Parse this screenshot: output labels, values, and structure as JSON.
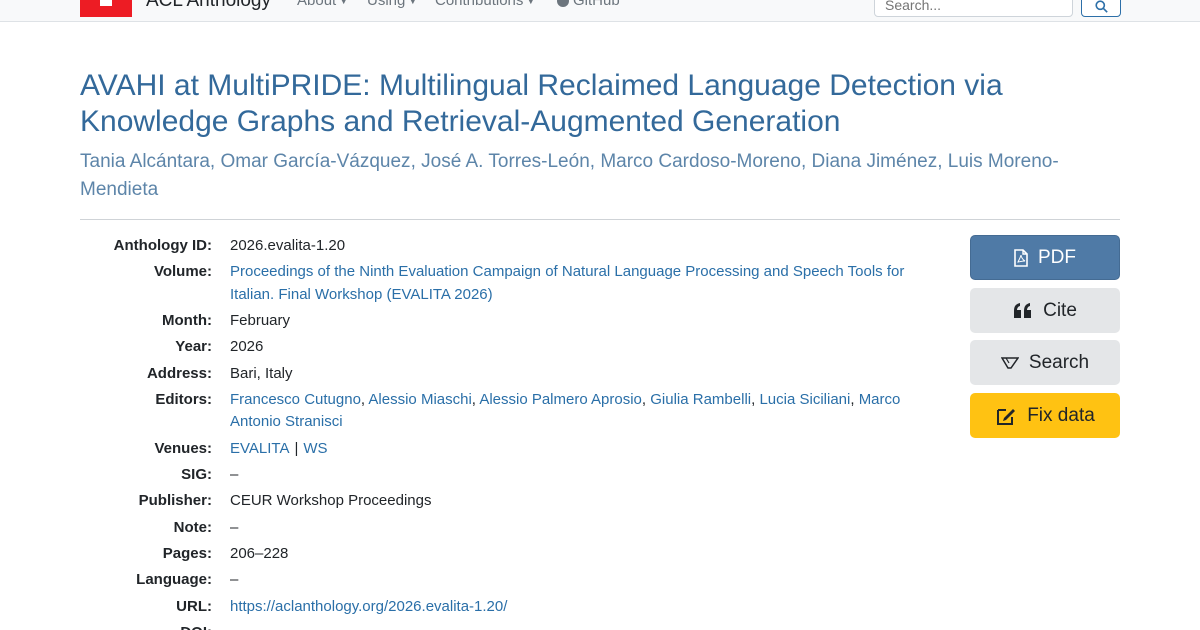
{
  "nav": {
    "brand": "ACL Anthology",
    "items": [
      {
        "label": "About"
      },
      {
        "label": "Using"
      },
      {
        "label": "Contributions"
      },
      {
        "label": "GitHub"
      }
    ],
    "search_placeholder": "Search..."
  },
  "paper": {
    "title": "AVAHI at MultiPRIDE: Multilingual Reclaimed Language Detection via Knowledge Graphs and Retrieval-Augmented Generation",
    "authors": [
      "Tania Alcántara",
      "Omar García-Vázquez",
      "José A. Torres-León",
      "Marco Cardoso-Moreno",
      "Diana Jiménez",
      "Luis Moreno-Mendieta"
    ]
  },
  "details": {
    "anthology_id": {
      "label": "Anthology ID:",
      "value": "2026.evalita-1.20"
    },
    "volume": {
      "label": "Volume:",
      "value": "Proceedings of the Ninth Evaluation Campaign of Natural Language Processing and Speech Tools for Italian. Final Workshop (EVALITA 2026)"
    },
    "month": {
      "label": "Month:",
      "value": "February"
    },
    "year": {
      "label": "Year:",
      "value": "2026"
    },
    "address": {
      "label": "Address:",
      "value": "Bari, Italy"
    },
    "editors": {
      "label": "Editors:",
      "values": [
        "Francesco Cutugno",
        "Alessio Miaschi",
        "Alessio Palmero Aprosio",
        "Giulia Rambelli",
        "Lucia Siciliani",
        "Marco Antonio Stranisci"
      ]
    },
    "venues": {
      "label": "Venues:",
      "values": [
        "EVALITA",
        "WS"
      ],
      "separator": "|"
    },
    "sig": {
      "label": "SIG:",
      "value": "–"
    },
    "publisher": {
      "label": "Publisher:",
      "value": "CEUR Workshop Proceedings"
    },
    "note": {
      "label": "Note:",
      "value": "–"
    },
    "pages": {
      "label": "Pages:",
      "value": "206–228"
    },
    "language": {
      "label": "Language:",
      "value": "–"
    },
    "url": {
      "label": "URL:",
      "value": "https://aclanthology.org/2026.evalita-1.20/"
    },
    "doi": {
      "label": "DOI:",
      "value": ""
    }
  },
  "actions": {
    "pdf": "PDF",
    "cite": "Cite",
    "search": "Search",
    "fix": "Fix data"
  },
  "icons": {
    "pdf": "file-pdf-icon",
    "cite": "quote-icon",
    "search": "semantic-scholar-icon",
    "fix": "edit-icon",
    "nav_search": "search-icon",
    "github": "github-icon"
  },
  "colors": {
    "title": "#33699a",
    "link": "#2a6fa8",
    "pdf_button": "#4f7aa6",
    "fix_button": "#ffc212",
    "logo": "#ed1c24"
  }
}
